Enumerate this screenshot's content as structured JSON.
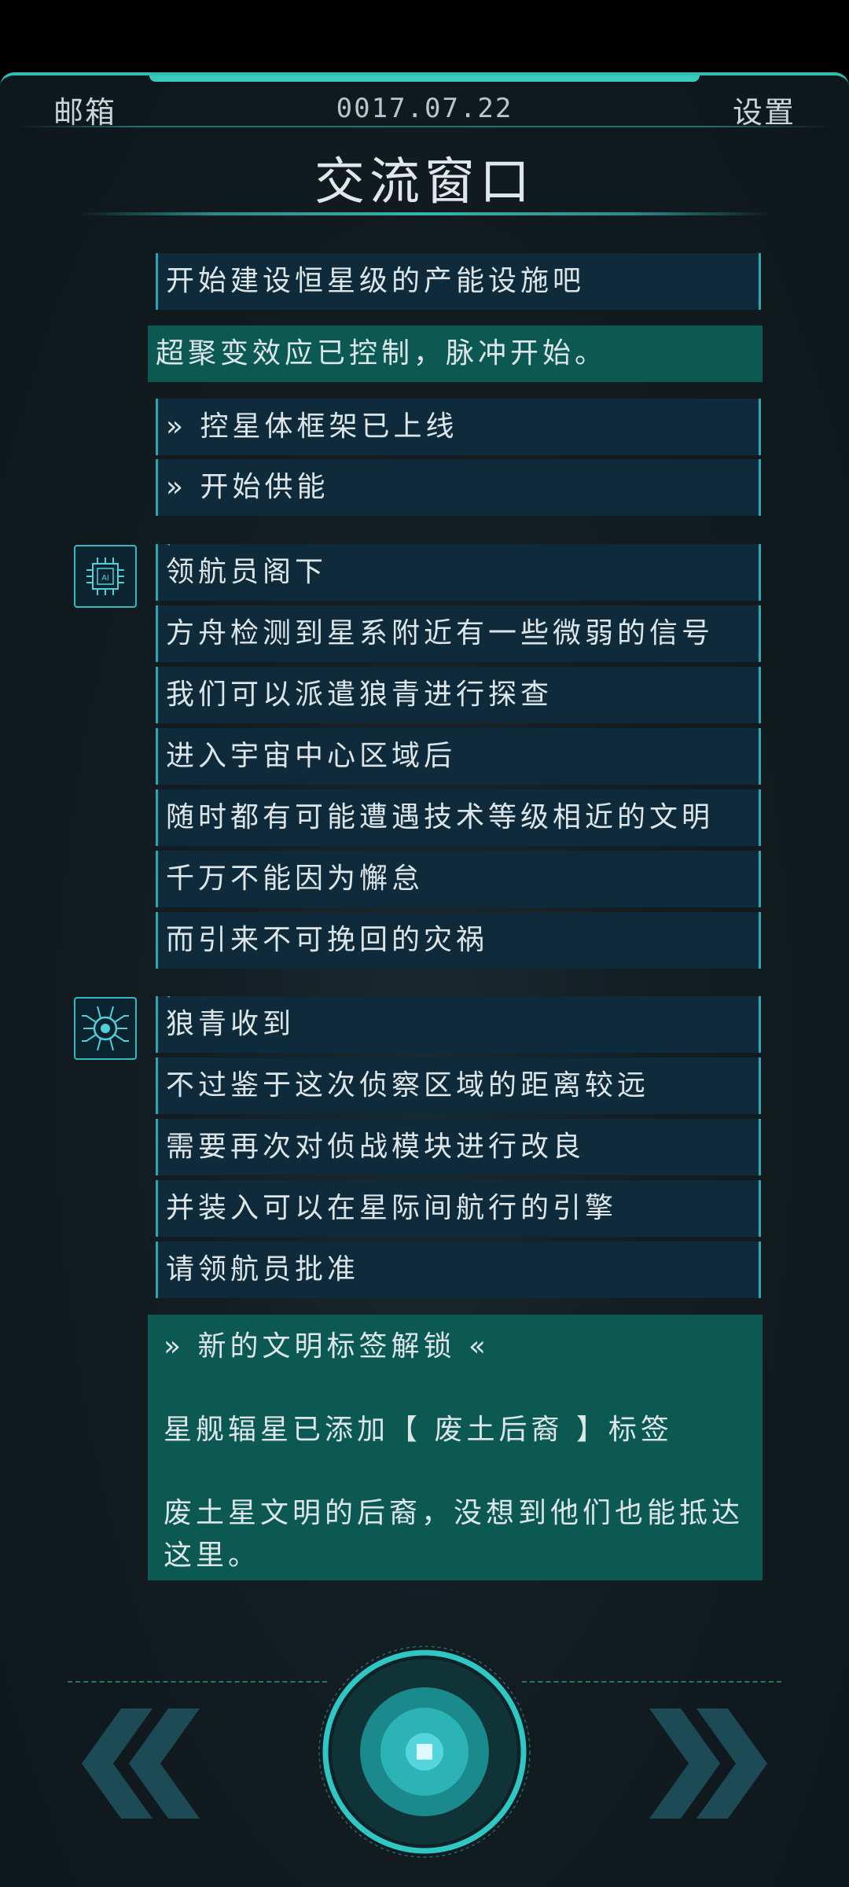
{
  "header": {
    "mailbox_label": "邮箱",
    "date": "0017.07.22",
    "settings_label": "设置",
    "title": "交流窗口"
  },
  "messages": {
    "m1": "开始建设恒星级的产能设施吧",
    "m2": "超聚变效应已控制，脉冲开始。",
    "m3": "» 控星体框架已上线",
    "m4": "» 开始供能",
    "ai": [
      "领航员阁下",
      "方舟检测到星系附近有一些微弱的信号",
      "我们可以派遣狼青进行探查",
      "进入宇宙中心区域后",
      "随时都有可能遭遇技术等级相近的文明",
      "千万不能因为懈怠",
      "而引来不可挽回的灾祸"
    ],
    "bot": [
      "狼青收到",
      "不过鉴于这次侦察区域的距离较远",
      "需要再次对侦战模块进行改良",
      "并装入可以在星际间航行的引擎",
      "请领航员批准"
    ]
  },
  "unlock_card": {
    "heading": "» 新的文明标签解锁 «",
    "line1": "星舰辐星已添加【 废土后裔 】标签",
    "line2": "废土星文明的后裔，没想到他们也能抵达这里。"
  },
  "icons": {
    "ai_avatar": "ai-chip-icon",
    "bot_avatar": "circuit-bug-icon",
    "prev": "double-chevron-left-icon",
    "next": "double-chevron-right-icon",
    "main": "round-action-button"
  },
  "colors": {
    "accent": "#39c9bd",
    "bar_bg": "#0f2a3a",
    "highlight_bg": "#0c5852",
    "text": "#dce6e8"
  }
}
